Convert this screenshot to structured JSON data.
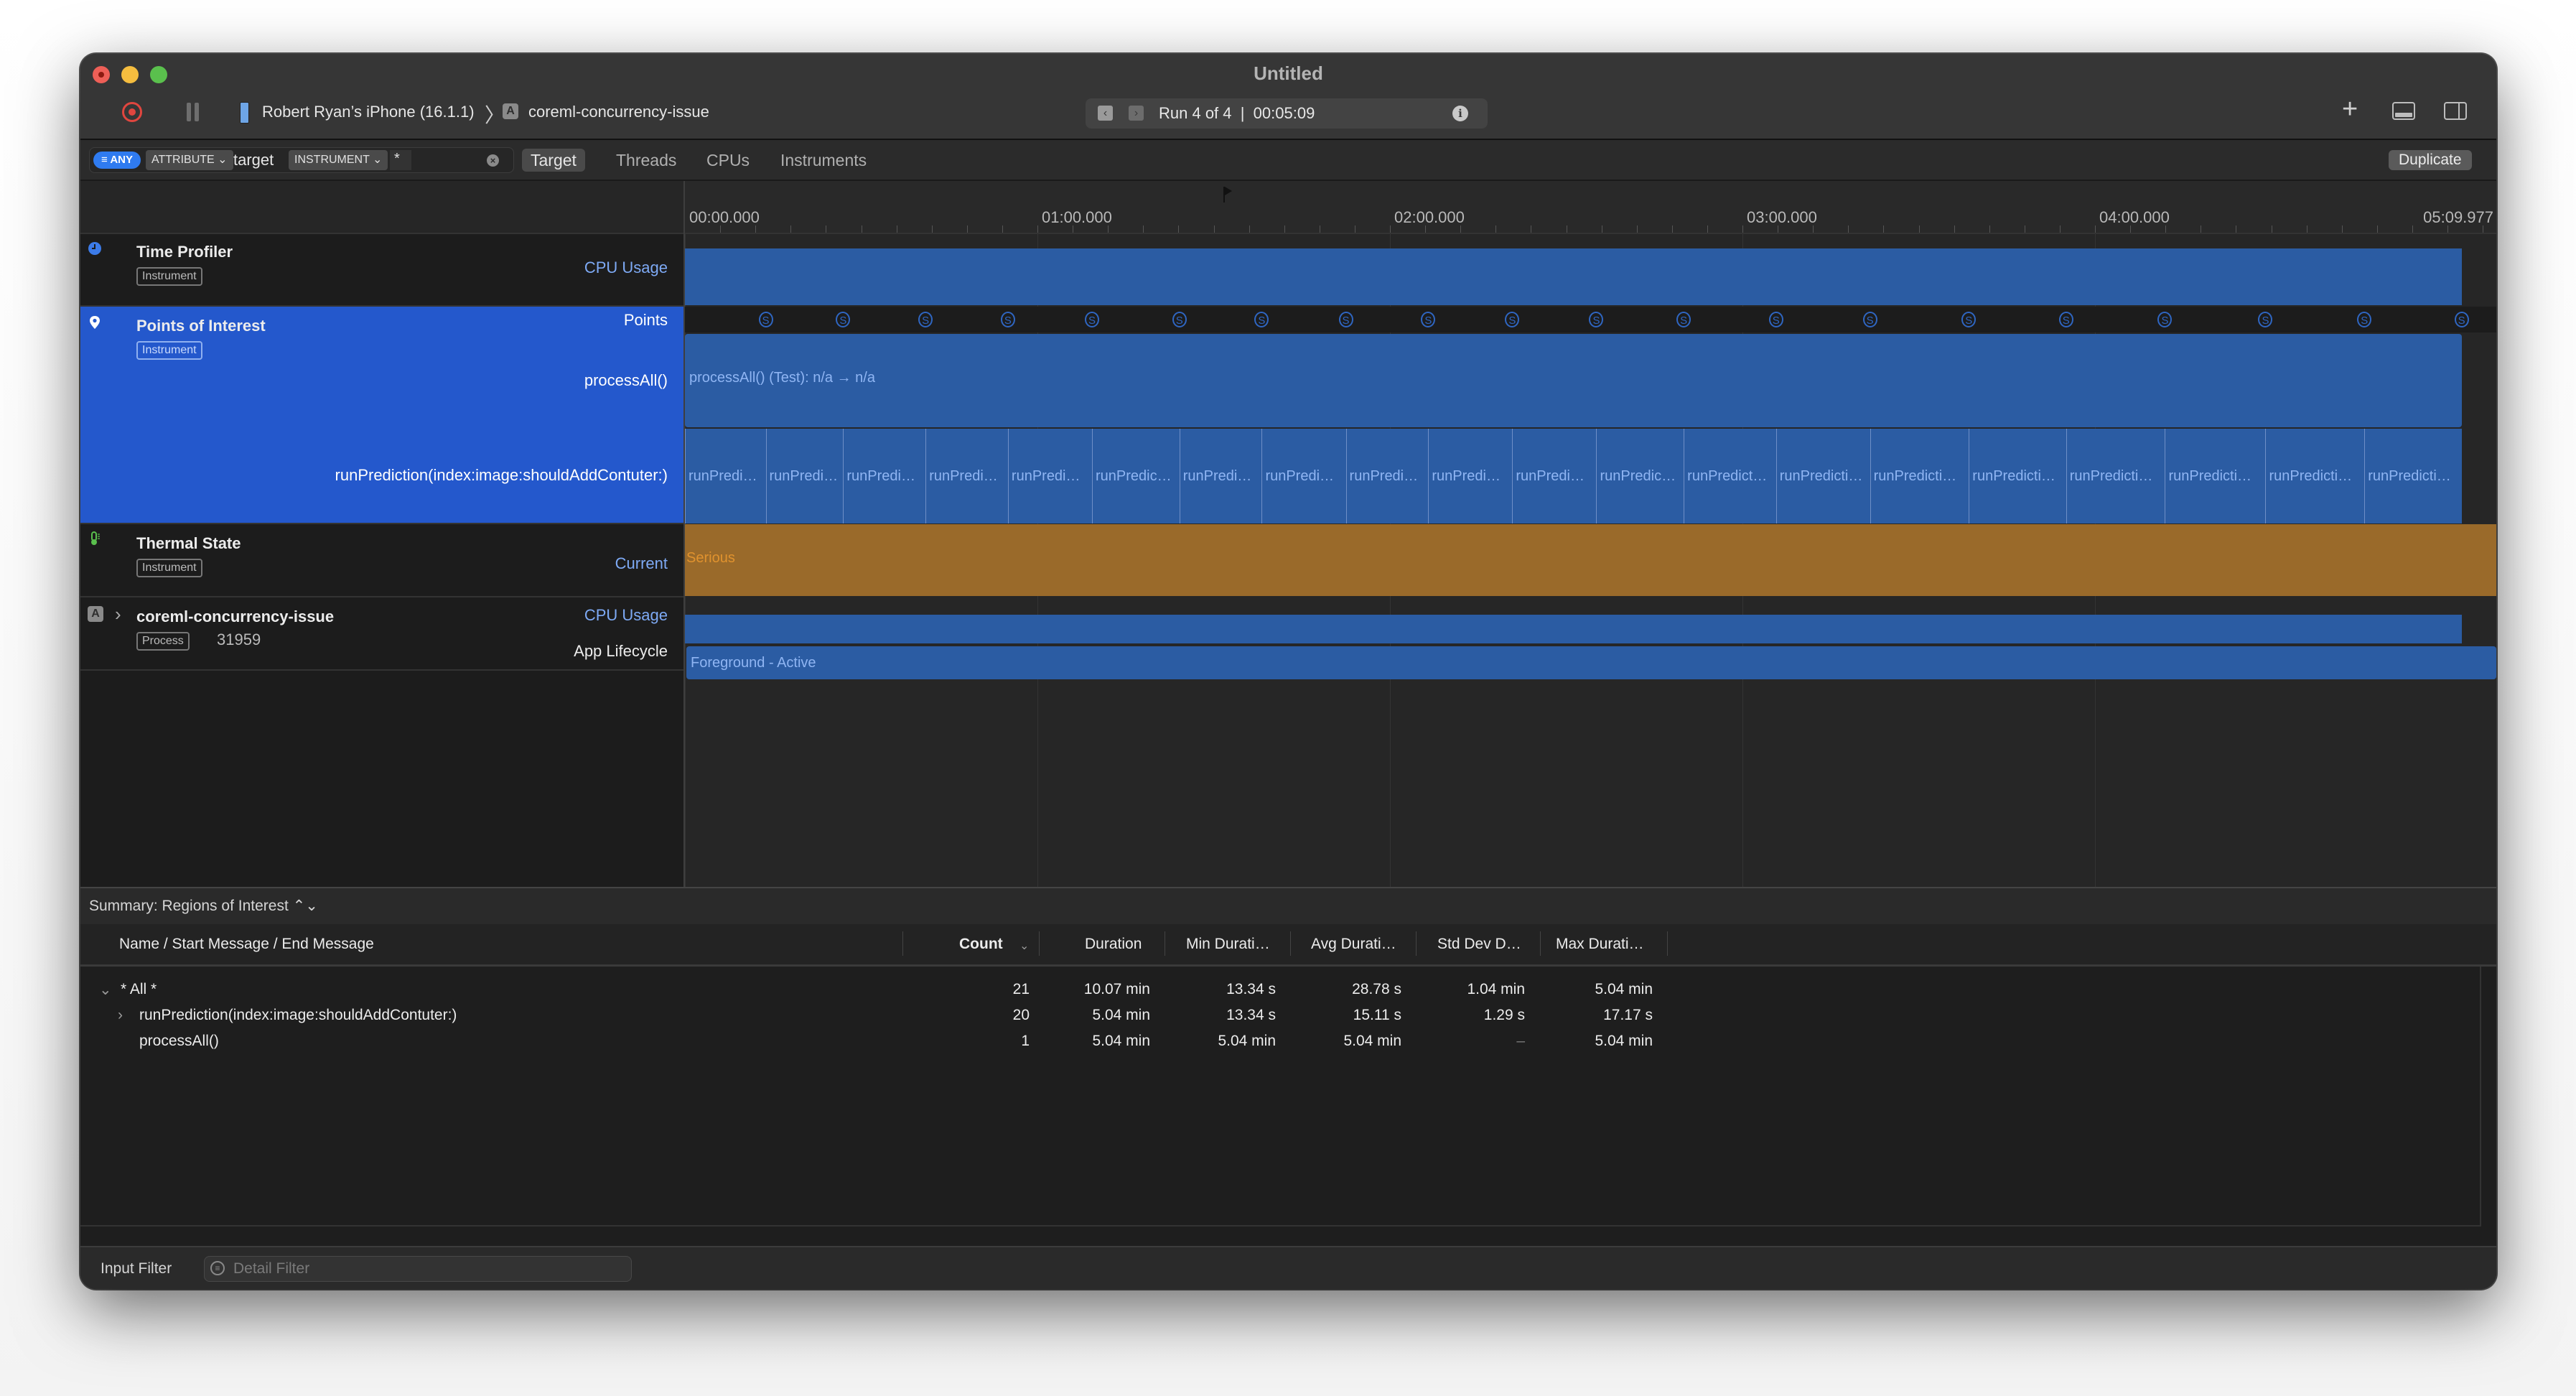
{
  "window": {
    "title": "Untitled"
  },
  "toolbar": {
    "device": "Robert Ryan’s iPhone (16.1.1)",
    "breadcrumb_separator": "〉",
    "app_icon_glyph": "A",
    "target_app": "coreml-concurrency-issue",
    "run_prev_glyph": "‹",
    "run_next_glyph": "›",
    "run_label": "Run 4 of 4  |  00:05:09",
    "info_glyph": "i",
    "add_glyph": "+"
  },
  "filter_bar": {
    "any_label": "≡ ANY",
    "attribute_label": "ATTRIBUTE ⌄",
    "target_text": "target",
    "instrument_label": "INSTRUMENT ⌄",
    "value_text": "*",
    "clear_glyph": "×",
    "strategy_tabs": [
      {
        "label": "Target",
        "active": true
      },
      {
        "label": "Threads",
        "active": false
      },
      {
        "label": "CPUs",
        "active": false
      },
      {
        "label": "Instruments",
        "active": false
      }
    ],
    "duplicate_label": "Duplicate"
  },
  "ruler": {
    "labels": [
      "00:00.000",
      "01:00.000",
      "02:00.000",
      "03:00.000",
      "04:00.000"
    ],
    "end_label": "05:09.977",
    "total_seconds": 309.977
  },
  "tracks": [
    {
      "title": "Time Profiler",
      "badge": "Instrument",
      "lanes": [
        "CPU Usage"
      ]
    },
    {
      "title": "Points of Interest",
      "badge": "Instrument",
      "lanes": [
        "Points",
        "processAll()",
        "runPrediction(index:image:shouldAddContuter:)"
      ]
    },
    {
      "title": "Thermal State",
      "badge": "Instrument",
      "lanes": [
        "Current"
      ]
    },
    {
      "title": "coreml-concurrency-issue",
      "badge": "Process",
      "pid": "31959",
      "lanes": [
        "CPU Usage",
        "App Lifecycle"
      ]
    }
  ],
  "timeline": {
    "process_all_label": "processAll() (Test): n/a → n/a",
    "process_all_seconds": [
      0,
      302.4
    ],
    "signpost_glyph": "S",
    "thermal_label": "Serious",
    "lifecycle_label": "Foreground - Active",
    "run_prediction_segments": [
      {
        "start": 0.0,
        "label": "runPredi…"
      },
      {
        "start": 13.75,
        "label": "runPredi…"
      },
      {
        "start": 26.93,
        "label": "runPredi…"
      },
      {
        "start": 40.96,
        "label": "runPredi…"
      },
      {
        "start": 54.98,
        "label": "runPredi…"
      },
      {
        "start": 69.29,
        "label": "runPredic…"
      },
      {
        "start": 84.16,
        "label": "runPredi…"
      },
      {
        "start": 98.18,
        "label": "runPredi…"
      },
      {
        "start": 112.49,
        "label": "runPredi…"
      },
      {
        "start": 126.52,
        "label": "runPredi…"
      },
      {
        "start": 140.82,
        "label": "runPredi…"
      },
      {
        "start": 155.13,
        "label": "runPredic…"
      },
      {
        "start": 170.0,
        "label": "runPredict…"
      },
      {
        "start": 185.71,
        "label": "runPredicti…"
      },
      {
        "start": 201.7,
        "label": "runPredicti…"
      },
      {
        "start": 218.53,
        "label": "runPredicti…"
      },
      {
        "start": 235.08,
        "label": "runPredicti…"
      },
      {
        "start": 251.91,
        "label": "runPredicti…"
      },
      {
        "start": 269.02,
        "label": "runPredicti…"
      },
      {
        "start": 285.85,
        "label": "runPredicti…"
      }
    ]
  },
  "detail": {
    "summary_label": "Summary: Regions of Interest ⌃⌄",
    "columns": [
      "Name / Start Message / End Message",
      "Count",
      "Duration",
      "Min Durati…",
      "Avg Durati…",
      "Std Dev D…",
      "Max Durati…"
    ],
    "sort_glyph": "⌄",
    "rows": [
      {
        "disclosure": "⌄",
        "name": "* All *",
        "count": "21",
        "duration": "10.07 min",
        "min": "13.34 s",
        "avg": "28.78 s",
        "std": "1.04 min",
        "max": "5.04 min"
      },
      {
        "disclosure": "›",
        "name": "runPrediction(index:image:shouldAddContuter:)",
        "count": "20",
        "duration": "5.04 min",
        "min": "13.34 s",
        "avg": "15.11 s",
        "std": "1.29 s",
        "max": "17.17 s"
      },
      {
        "disclosure": "",
        "name": "processAll()",
        "count": "1",
        "duration": "5.04 min",
        "min": "5.04 min",
        "avg": "5.04 min",
        "std": "–",
        "max": "5.04 min"
      }
    ]
  },
  "bottom": {
    "input_filter_label": "Input Filter",
    "detail_filter_placeholder": "Detail Filter",
    "filter_icon_glyph": "≡"
  },
  "colors": {
    "selection": "#2458cc",
    "track_bar": "#2b5ca3",
    "thermal_serious": "#9a6a2a",
    "thermal_text": "#e0922e",
    "lane_label": "#7eaaf5"
  }
}
